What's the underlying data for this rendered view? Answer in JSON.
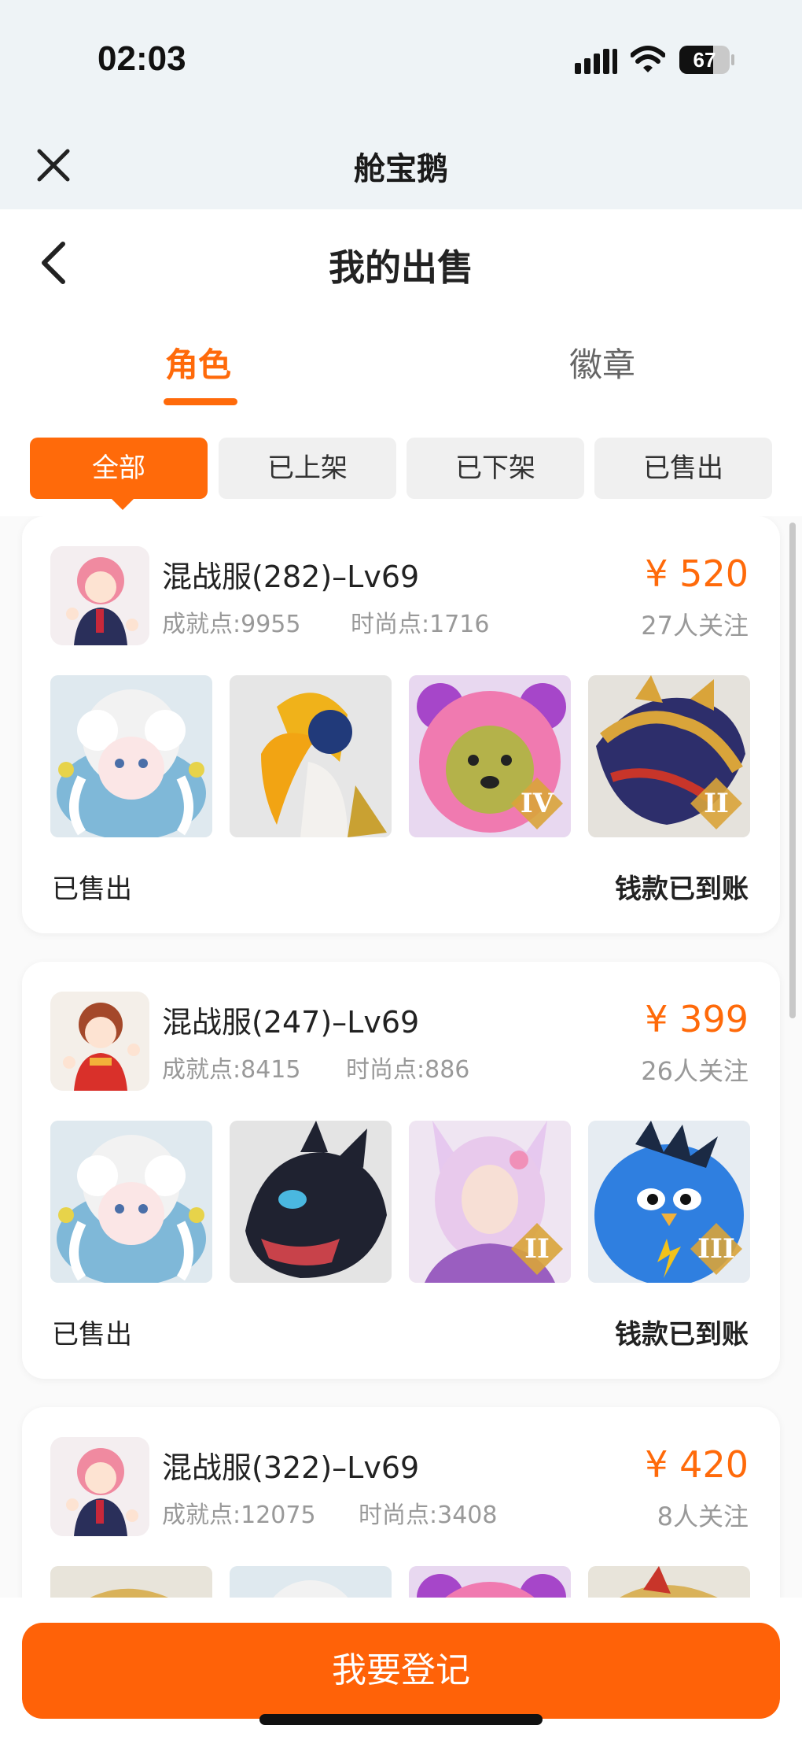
{
  "status_bar": {
    "time": "02:03",
    "battery_level": "67"
  },
  "app": {
    "title": "舱宝鹅"
  },
  "page": {
    "title": "我的出售"
  },
  "tabs": [
    {
      "label": "角色",
      "active": true
    },
    {
      "label": "徽章",
      "active": false
    }
  ],
  "filters": [
    {
      "label": "全部",
      "active": true
    },
    {
      "label": "已上架",
      "active": false
    },
    {
      "label": "已下架",
      "active": false
    },
    {
      "label": "已售出",
      "active": false
    }
  ],
  "listings": [
    {
      "server": "混战服(282)–Lv69",
      "achievement": "成就点:9955",
      "fashion": "时尚点:1716",
      "price": "¥ 520",
      "followers": "27人关注",
      "status": "已售出",
      "payment": "钱款已到账",
      "items": [
        {
          "name": "white-curly-hair-doll",
          "rank": ""
        },
        {
          "name": "hornbill-bird",
          "rank": ""
        },
        {
          "name": "pink-bear-pet",
          "rank": "IV"
        },
        {
          "name": "golden-dragon",
          "rank": "II"
        }
      ]
    },
    {
      "server": "混战服(247)–Lv69",
      "achievement": "成就点:8415",
      "fashion": "时尚点:886",
      "price": "¥ 399",
      "followers": "26人关注",
      "status": "已售出",
      "payment": "钱款已到账",
      "items": [
        {
          "name": "white-curly-hair-doll",
          "rank": ""
        },
        {
          "name": "black-dragon",
          "rank": ""
        },
        {
          "name": "fox-spirit",
          "rank": "II"
        },
        {
          "name": "blue-bird",
          "rank": "III"
        }
      ]
    },
    {
      "server": "混战服(322)–Lv69",
      "achievement": "成就点:12075",
      "fashion": "时尚点:3408",
      "price": "¥ 420",
      "followers": "8人关注",
      "status": "",
      "payment": "",
      "items": [
        {
          "name": "gold-dragon-partial",
          "rank": ""
        },
        {
          "name": "white-curly-hair-doll",
          "rank": ""
        },
        {
          "name": "pink-pet-partial",
          "rank": ""
        },
        {
          "name": "gold-beast-partial",
          "rank": ""
        }
      ]
    }
  ],
  "bottom": {
    "register_label": "我要登记"
  },
  "colors": {
    "accent": "#ff6a0a",
    "price": "#ff6a0a",
    "chip_bg": "#f0f0f0"
  }
}
